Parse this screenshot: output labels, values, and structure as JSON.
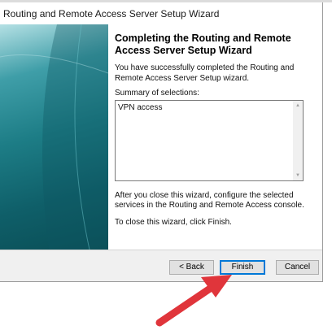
{
  "window": {
    "title": "Routing and Remote Access Server Setup Wizard"
  },
  "content": {
    "heading": "Completing the Routing and Remote Access Server Setup Wizard",
    "intro": "You have successfully completed the Routing and Remote Access Server Setup wizard.",
    "summary_label": "Summary of selections:",
    "summary_text": "VPN access",
    "after_text": "After you close this wizard, configure the selected services in the Routing and  Remote Access console.",
    "close_text": "To close this wizard, click Finish."
  },
  "buttons": {
    "back": "< Back",
    "finish": "Finish",
    "cancel": "Cancel"
  },
  "icons": {
    "scroll_up": "scroll-up-icon",
    "scroll_down": "scroll-down-icon",
    "annotation": "red-arrow-icon"
  },
  "colors": {
    "accent": "#0078d7",
    "annotation_arrow": "#e0353b",
    "panel_teal": "#1d7d86"
  }
}
